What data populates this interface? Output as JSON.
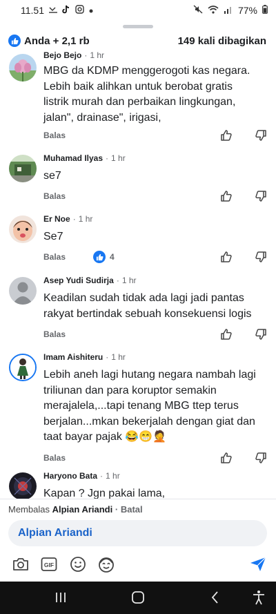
{
  "status_bar": {
    "time": "11.51",
    "battery": "77%"
  },
  "sheet_header": {
    "reactions": "Anda + 2,1 rb",
    "shares": "149 kali dibagikan"
  },
  "comments": [
    {
      "author": "Bejo Bejo",
      "time": "1 hr",
      "lines": [
        "MBG da KDMP menggerogoti kas negara.",
        "Lebih baik alihkan untuk berobat gratis",
        "listrik murah dan perbaikan lingkungan,",
        "jalan\", drainase\", irigasi,"
      ],
      "reply_label": "Balas",
      "like_count": ""
    },
    {
      "author": "Muhamad Ilyas",
      "time": "1 hr",
      "lines": [
        "se7"
      ],
      "reply_label": "Balas",
      "like_count": ""
    },
    {
      "author": "Er Noe",
      "time": "1 hr",
      "lines": [
        "Se7"
      ],
      "reply_label": "Balas",
      "like_count": "4"
    },
    {
      "author": "Asep Yudi Sudirja",
      "time": "1 hr",
      "lines": [
        "Keadilan sudah tidak ada lagi jadi pantas",
        "rakyat bertindak sebuah konsekuensi logis"
      ],
      "reply_label": "Balas",
      "like_count": ""
    },
    {
      "author": "Imam Aishiteru",
      "time": "1 hr",
      "lines": [
        "Lebih aneh lagi hutang negara nambah lagi",
        "triliunan dan para koruptor semakin",
        "merajalela,...tapi tenang MBG ttep terus",
        "berjalan...mkan bekerjalah dengan giat dan",
        "taat bayar pajak 😂😁🤦"
      ],
      "reply_label": "Balas",
      "like_count": ""
    },
    {
      "author": "Haryono Bata",
      "time": "1 hr",
      "lines": [
        "Kapan ? Jgn pakai lama,"
      ],
      "reply_label": "",
      "like_count": ""
    }
  ],
  "reply_bar": {
    "prefix": "Membalas",
    "target": "Alpian Ariandi",
    "separator": "·",
    "cancel": "Batal",
    "input_value": "Alpian Ariandi"
  },
  "toolbar": {
    "icons": [
      "camera-icon",
      "gif-icon",
      "emoji-icon",
      "avatar-sticker-icon",
      "send-icon"
    ]
  },
  "colors": {
    "accent": "#1877f2",
    "mention": "#1a63c9",
    "meta": "#65676b"
  }
}
